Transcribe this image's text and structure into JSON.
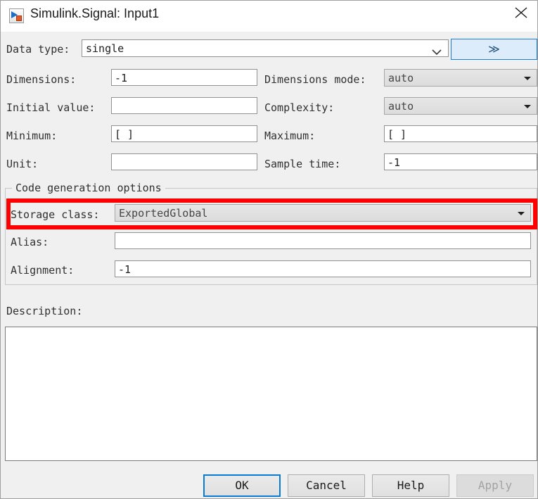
{
  "window": {
    "title": "Simulink.Signal: Input1",
    "icon": "simulink-signal-icon",
    "close_label": "×"
  },
  "form": {
    "data_type": {
      "label": "Data type:",
      "value": "single",
      "placeholder": "",
      "advanced_button_label": "≫"
    },
    "dimensions": {
      "label": "Dimensions:",
      "value": "-1"
    },
    "dimensions_mode": {
      "label": "Dimensions mode:",
      "value": "auto"
    },
    "initial_value": {
      "label": "Initial value:",
      "value": ""
    },
    "complexity": {
      "label": "Complexity:",
      "value": "auto"
    },
    "minimum": {
      "label": "Minimum:",
      "value": "[ ]"
    },
    "maximum": {
      "label": "Maximum:",
      "value": "[ ]"
    },
    "unit": {
      "label": "Unit:",
      "value": ""
    },
    "sample_time": {
      "label": "Sample time:",
      "value": "-1"
    }
  },
  "code_generation": {
    "group_label": "Code generation options",
    "storage_class": {
      "label": "Storage class:",
      "value": "ExportedGlobal"
    },
    "alias": {
      "label": "Alias:",
      "value": ""
    },
    "alignment": {
      "label": "Alignment:",
      "value": "-1"
    }
  },
  "description": {
    "label": "Description:",
    "value": ""
  },
  "buttons": {
    "ok": "OK",
    "cancel": "Cancel",
    "help": "Help",
    "apply": "Apply"
  },
  "colors": {
    "dialog_background": "#f0f0f0",
    "annotation_red": "#fe0000",
    "focus_blue": "#0a7bd4",
    "advanced_button_fill": "#dcecfb"
  }
}
